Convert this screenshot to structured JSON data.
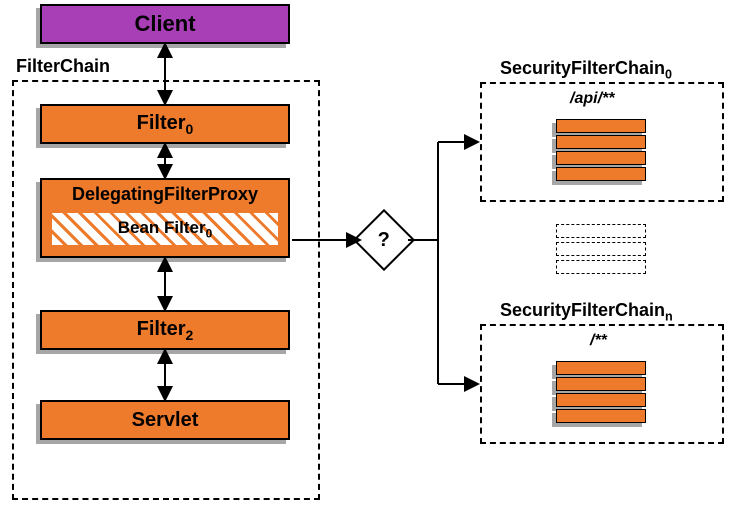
{
  "client_label": "Client",
  "filterchain_label": "FilterChain",
  "filter0_label": "Filter",
  "filter0_sub": "0",
  "delegating_label": "DelegatingFilterProxy",
  "bean_filter_label": "Bean Filter",
  "bean_filter_sub": "0",
  "filter2_label": "Filter",
  "filter2_sub": "2",
  "servlet_label": "Servlet",
  "decision_label": "?",
  "chain0_title": "SecurityFilterChain",
  "chain0_sub": "0",
  "chain0_pattern": "/api/**",
  "chain_n_title": "SecurityFilterChain",
  "chain_n_sub": "n",
  "chain_n_pattern": "/**"
}
